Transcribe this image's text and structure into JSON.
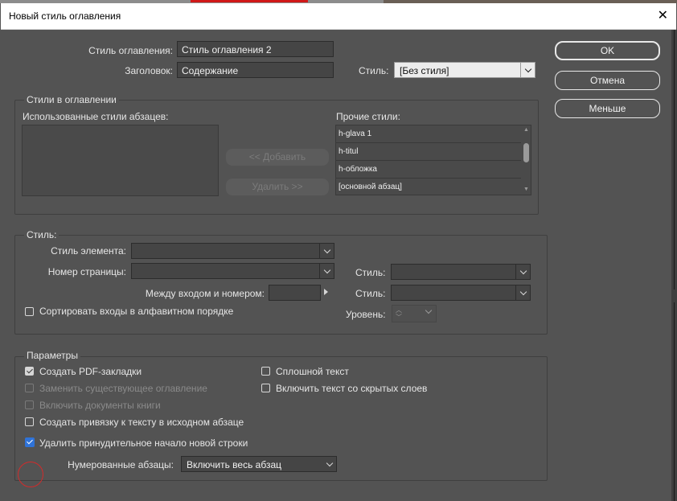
{
  "window": {
    "title": "Новый стиль оглавления",
    "close_glyph": "✕"
  },
  "header": {
    "toc_style_label": "Стиль оглавления:",
    "toc_style_value": "Стиль оглавления 2",
    "title_label": "Заголовок:",
    "title_value": "Содержание",
    "style_label": "Стиль:",
    "style_value": "[Без стиля]"
  },
  "buttons": {
    "ok": "OK",
    "cancel": "Отмена",
    "less": "Меньше"
  },
  "toc_styles": {
    "group_title": "Стили в оглавлении",
    "used_label": "Использованные стили абзацев:",
    "add_button": "<< Добавить",
    "remove_button": "Удалить >>",
    "other_label": "Прочие стили:",
    "other_styles": [
      "h-glava 1",
      "h-titul",
      "h-обложка",
      "[основной абзац]"
    ]
  },
  "style_group": {
    "group_title": "Стиль:",
    "entry_style_label": "Стиль элемента:",
    "page_number_label": "Номер страницы:",
    "page_number_style_label": "Стиль:",
    "between_label": "Между входом и номером:",
    "between_style_label": "Стиль:",
    "sort_label": "Сортировать входы в алфавитном порядке",
    "level_label": "Уровень:"
  },
  "options": {
    "group_title": "Параметры",
    "create_pdf_bookmarks": "Создать PDF-закладки",
    "replace_existing": "Заменить существующее оглавление",
    "include_book_docs": "Включить документы книги",
    "create_text_anchor": "Создать привязку к тексту в исходном абзаце",
    "remove_forced_line_breaks": "Удалить принудительное начало новой строки",
    "run_in": "Сплошной текст",
    "include_hidden_layers": "Включить текст со скрытых слоев",
    "numbered_paragraphs_label": "Нумерованные абзацы:",
    "numbered_paragraphs_value": "Включить весь абзац"
  },
  "icons": {
    "chevron": "chevron-down-icon",
    "checkmark": "checkmark-icon",
    "arrow_right": "arrow-right-icon",
    "spinner": "stepper-icon"
  },
  "colors": {
    "dialog_bg": "#535353",
    "checkbox_checked_blue": "#2f73d8",
    "highlight_circle": "#d22b2b"
  }
}
